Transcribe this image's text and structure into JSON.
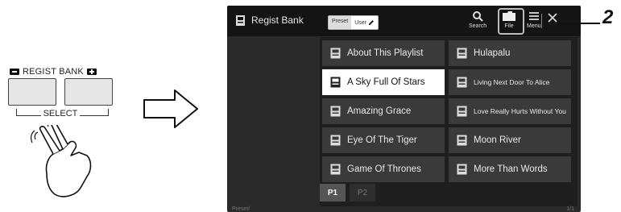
{
  "panel": {
    "regist_bank_label": "REGIST BANK",
    "select_label": "SELECT"
  },
  "screen": {
    "title": "Regist Bank",
    "toggle": {
      "preset": "Preset",
      "user": "User"
    },
    "toolbar": {
      "search": "Search",
      "file": "File",
      "menu": "Menu"
    },
    "items": [
      {
        "label": "About This Playlist",
        "selected": false
      },
      {
        "label": "Hulapalu",
        "selected": false
      },
      {
        "label": "A Sky Full Of Stars",
        "selected": true
      },
      {
        "label": "Living Next Door To Alice",
        "selected": false
      },
      {
        "label": "Amazing Grace",
        "selected": false
      },
      {
        "label": "Love Really Hurts Without You",
        "selected": false
      },
      {
        "label": "Eye Of The Tiger",
        "selected": false
      },
      {
        "label": "Moon River",
        "selected": false
      },
      {
        "label": "Game Of Thrones",
        "selected": false
      },
      {
        "label": "More Than Words",
        "selected": false
      }
    ],
    "tabs": [
      {
        "label": "P1",
        "active": true
      },
      {
        "label": "P2",
        "active": false
      }
    ],
    "path": "Preset/",
    "page_indicator": "1/1"
  },
  "callout": {
    "number": "2"
  },
  "colors": {
    "screen_bg": "#2a2a2a",
    "item_bg": "#3a3a3a",
    "selected_bg": "#ffffff",
    "topbar_bg": "#141414"
  }
}
